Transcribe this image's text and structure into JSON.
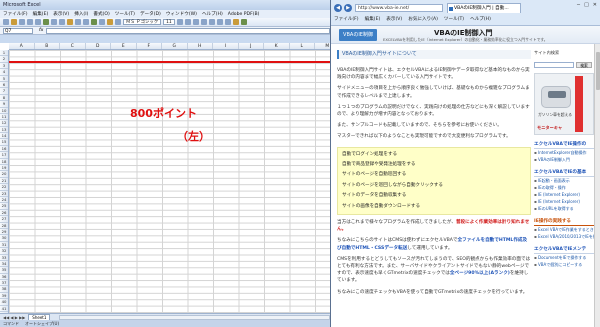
{
  "excel": {
    "title": "Microsoft Excel",
    "menu": [
      "ファイル(F)",
      "編集(E)",
      "表示(V)",
      "挿入(I)",
      "書式(O)",
      "ツール(T)",
      "データ(D)",
      "ウィンドウ(W)",
      "ヘルプ(H)",
      "Adobe PDF(B)"
    ],
    "font_name": "ＭＳ Ｐゴシック",
    "font_size": "11",
    "name_box": "Q7",
    "fx": "fx",
    "columns": [
      "A",
      "B",
      "C",
      "D",
      "E",
      "F",
      "G",
      "H",
      "I",
      "J",
      "K",
      "L",
      "M"
    ],
    "rows": [
      "1",
      "2",
      "3",
      "4",
      "5",
      "6",
      "7",
      "8",
      "9",
      "10",
      "11",
      "12",
      "13",
      "14",
      "15",
      "16",
      "17",
      "18",
      "19",
      "20",
      "21",
      "22",
      "23",
      "24",
      "25",
      "26",
      "27",
      "28",
      "29",
      "30",
      "31",
      "32",
      "33",
      "34",
      "35",
      "36",
      "37",
      "38",
      "39",
      "40",
      "41"
    ],
    "annotation_line1": "800ポイント",
    "annotation_line2": "（左）",
    "sheet_nav": "◀◀ ◀ ▶ ▶▶",
    "sheet_tab": "Sheet1",
    "status_left": "コマンド",
    "status_mid": "オートシェイプ(U)",
    "accent_red": "#e01010"
  },
  "browser": {
    "url": "http://www.vba-ie.net/",
    "tab_title": "VBAのIE制御入門 | 自動...",
    "menu": [
      "ファイル(F)",
      "編集(E)",
      "表示(V)",
      "お気に入り(A)",
      "ツール(T)",
      "ヘルプ(H)"
    ],
    "window_controls": [
      "─",
      "□",
      "✕"
    ]
  },
  "site": {
    "logo_text": "VBAのIE制御",
    "title": "VBAのIE制御入門",
    "description": "EXCELVBAを利用したIE（Internet Explorer）の自動化・業務効率化に役立つ入門サイトです。",
    "main_title": "VBAのIE制御入門サイトについて",
    "para1": "VBAのIE制御入門サイトは、エクセルVBAによるIE制御やデータ取得など基本的なものから実践向けの内容まで幅広くカバーしている入門サイトです。",
    "para2": "サイドメニューの項目を上から順序良く勉強していけば、基礎なものから複雑なプログラムまで作成できるレベルまで上達します。",
    "para3": "１つ１つのプログラムの説明だけでなく、実践向けの処理の仕方などにも深く解説していますので、より理解力が増す内容となっております。",
    "para4": "また、サンプルコードも記載していますので、そちらを参考にお使いください。",
    "para5": "マスターできれば以下のようなことも実現可能ですので大変便利なプログラムです。",
    "examples": [
      "自動でログイン処理をする",
      "自動で商品登録や受発注処理をする",
      "サイトのページを自動巡回する",
      "サイトのページを巡回しながら自動クリックする",
      "サイトのデータを自動収集する",
      "サイトの画像を自動ダウンロードする"
    ],
    "para6_pre": "当方はこれまで様々なプログラムを作成してきましたが、",
    "para6_hl": "普段によく作業効率は計り知れません。",
    "para7_pre": "ちなみにこちらのサイトはCMSは使わずにエクセルVBAで",
    "para7_hl": "全ファイルを自動でHTML作成及び自動でHTML・CSSデータ転送",
    "para7_post": "して運用しています。",
    "para8": "CMSを利用するとどうしてもソースが汚れてしまうので、SEO的観点からも作業効率の面ではとても有利な方法です。また、サーバサイドやクライアントサイドでもない静的webページですので、表示速度も早くGTmetrixの速度チェックでは",
    "para8_hl": "全ページ90%以上(Aランク)",
    "para8_post": "を維持しています。",
    "para9": "ちなみにこの速度チェックもVBAを使って自動でGTmetrixの速度チェックを行っています。"
  },
  "sidebar": {
    "site_search": "サイト内検索",
    "search_button": "検索",
    "ad_text": "ガソリン車を超える",
    "ad_sub": "無料モニター",
    "ad_title": "モニターキャ",
    "section1": "エクセルVBAでIE操作の",
    "section1_links": [
      "InternetExplorer自動操作",
      "VBAのIE制御入門",
      "IEオブジェクトの基本",
      "IEの起動と終了"
    ],
    "section2": "エクセルVBAでIEの基本",
    "section2_links": [
      "IE起動・画面表示",
      "IEの取得・操作",
      "IE (Internet Explorer)",
      "IE (Internet Explorer)",
      "IEのURLを取得する",
      "IEの表示をする"
    ],
    "section3": "IE操作の実践する",
    "section3_links": [
      "Excel VBAでIE作業をするときのコツ",
      "Excel VBA/2010/2013でIEを操作する"
    ],
    "section4": "エクセルVBAでIEメンテ",
    "section4_links": [
      "DocumentをIEで操作する",
      "VBAで個別にコピーする"
    ]
  }
}
